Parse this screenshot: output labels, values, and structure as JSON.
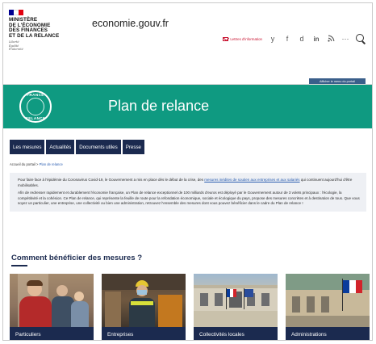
{
  "header": {
    "ministry_lines": [
      "MINISTÈRE",
      "DE L'ÉCONOMIE",
      "DES FINANCES",
      "ET DE LA RELANCE"
    ],
    "motto_lines": [
      "Liberté",
      "Égalité",
      "Fraternité"
    ],
    "site_name": "economie.gouv.fr",
    "newsletter_label": "Lettres d'information",
    "social_icons": [
      "twitter-icon",
      "facebook-icon",
      "dailymotion-icon",
      "linkedin-icon",
      "rss-icon",
      "more-icon"
    ],
    "social_glyphs": [
      "y",
      "f",
      "d",
      "in",
      "ɐ",
      "···"
    ],
    "portal_menu_label": "Afficher le menu du portail"
  },
  "banner": {
    "title": "Plan de relance",
    "badge_top": "FRANCE",
    "badge_bottom": "RELANCE",
    "color": "#0f9a81"
  },
  "nav": {
    "items": [
      "Les mesures",
      "Actualités",
      "Documents utiles",
      "Presse"
    ]
  },
  "breadcrumb": {
    "home": "Accueil du portail",
    "separator": " > ",
    "current": "Plan de relance"
  },
  "intro": {
    "p1_start": "Pour faire face à l'épidémie du Coronavirus Covid-19, le Gouvernement a mis en place dès le début de la crise, des ",
    "p1_link": "mesures inédites de soutien aux entreprises et aux salariés",
    "p1_end": " qui continuent aujourd'hui d'être mobilisables.",
    "p2": "Afin de redresser rapidement et durablement l'économie française, un Plan de relance exceptionnel de 100 milliards d'euros est déployé par le Gouvernement autour de 3 volets principaux : l'écologie, la compétitivité et la cohésion. Ce Plan de relance, qui représente la feuille de route pour la refondation économique, sociale et écologique du pays, propose des mesures concrètes et à destination de tous. Que vous soyez un particulier, une entreprise, une collectivité ou bien une administration, retrouvez l'ensemble des mesures dont vous pouvez bénéficier dans le cadre du Plan de relance !"
  },
  "section": {
    "title": "Comment bénéficier des mesures ?"
  },
  "cards": [
    {
      "label": "Particuliers"
    },
    {
      "label": "Entreprises"
    },
    {
      "label": "Collectivités locales"
    },
    {
      "label": "Administrations"
    }
  ],
  "colors": {
    "navy": "#1b2a4f",
    "accent_red": "#c8102e",
    "link_blue": "#2a5db0"
  }
}
